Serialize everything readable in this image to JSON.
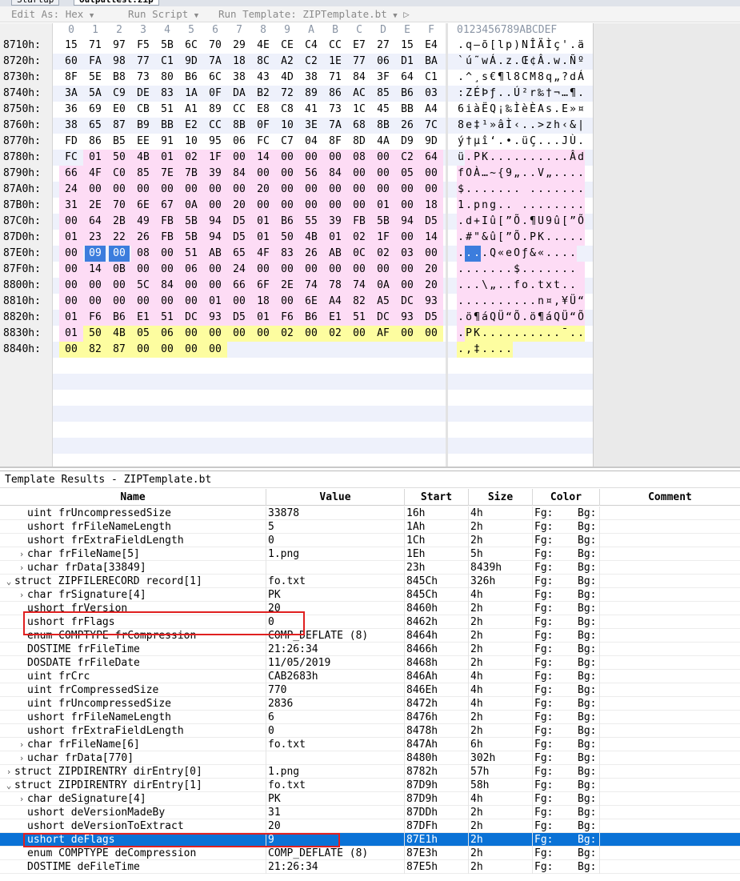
{
  "tabs": [
    {
      "label": "Startup",
      "active": false
    },
    {
      "label": "outputtest.zip",
      "active": true
    }
  ],
  "toolbar": {
    "edit_as": "Edit As: Hex",
    "run_script": "Run Script",
    "run_template": "Run Template: ZIPTemplate.bt"
  },
  "hex": {
    "column_header": [
      "0",
      "1",
      "2",
      "3",
      "4",
      "5",
      "6",
      "7",
      "8",
      "9",
      "A",
      "B",
      "C",
      "D",
      "E",
      "F"
    ],
    "ascii_header": "0123456789ABCDEF",
    "rows": [
      {
        "addr": "8710h:",
        "bytes": [
          "15",
          "71",
          "97",
          "F5",
          "5B",
          "6C",
          "70",
          "29",
          "4E",
          "CE",
          "C4",
          "CC",
          "E7",
          "27",
          "15",
          "E4"
        ],
        "ascii": ".q—õ[lp)NÎÄÌç'.ä"
      },
      {
        "addr": "8720h:",
        "bytes": [
          "60",
          "FA",
          "98",
          "77",
          "C1",
          "9D",
          "7A",
          "18",
          "8C",
          "A2",
          "C2",
          "1E",
          "77",
          "06",
          "D1",
          "BA"
        ],
        "ascii": "`ú˜wÁ.z.Œ¢Â.w.Ñº"
      },
      {
        "addr": "8730h:",
        "bytes": [
          "8F",
          "5E",
          "B8",
          "73",
          "80",
          "B6",
          "6C",
          "38",
          "43",
          "4D",
          "38",
          "71",
          "84",
          "3F",
          "64",
          "C1"
        ],
        "ascii": ".^¸s€¶l8CM8q„?dÁ"
      },
      {
        "addr": "8740h:",
        "bytes": [
          "3A",
          "5A",
          "C9",
          "DE",
          "83",
          "1A",
          "0F",
          "DA",
          "B2",
          "72",
          "89",
          "86",
          "AC",
          "85",
          "B6",
          "03"
        ],
        "ascii": ":ZÉÞƒ..Ú²r‰†¬…¶."
      },
      {
        "addr": "8750h:",
        "bytes": [
          "36",
          "69",
          "E0",
          "CB",
          "51",
          "A1",
          "89",
          "CC",
          "E8",
          "C8",
          "41",
          "73",
          "1C",
          "45",
          "BB",
          "A4"
        ],
        "ascii": "6iàËQ¡‰ÌèÈAs.E»¤"
      },
      {
        "addr": "8760h:",
        "bytes": [
          "38",
          "65",
          "87",
          "B9",
          "BB",
          "E2",
          "CC",
          "8B",
          "0F",
          "10",
          "3E",
          "7A",
          "68",
          "8B",
          "26",
          "7C"
        ],
        "ascii": "8e‡¹»âÌ‹..>zh‹&|"
      },
      {
        "addr": "8770h:",
        "bytes": [
          "FD",
          "86",
          "B5",
          "EE",
          "91",
          "10",
          "95",
          "06",
          "FC",
          "C7",
          "04",
          "8F",
          "8D",
          "4A",
          "D9",
          "9D"
        ],
        "ascii": "ý†µî‘.•.üÇ...JÙ."
      },
      {
        "addr": "8780h:",
        "bytes": [
          "FC",
          "01",
          "50",
          "4B",
          "01",
          "02",
          "1F",
          "00",
          "14",
          "00",
          "00",
          "00",
          "08",
          "00",
          "C2",
          "64"
        ],
        "ascii": "ü.PK..........Âd"
      },
      {
        "addr": "8790h:",
        "bytes": [
          "66",
          "4F",
          "C0",
          "85",
          "7E",
          "7B",
          "39",
          "84",
          "00",
          "00",
          "56",
          "84",
          "00",
          "00",
          "05",
          "00"
        ],
        "ascii": "fOÀ…~{9„..V„...."
      },
      {
        "addr": "87A0h:",
        "bytes": [
          "24",
          "00",
          "00",
          "00",
          "00",
          "00",
          "00",
          "00",
          "20",
          "00",
          "00",
          "00",
          "00",
          "00",
          "00",
          "00"
        ],
        "ascii": "$....... ......."
      },
      {
        "addr": "87B0h:",
        "bytes": [
          "31",
          "2E",
          "70",
          "6E",
          "67",
          "0A",
          "00",
          "20",
          "00",
          "00",
          "00",
          "00",
          "00",
          "01",
          "00",
          "18"
        ],
        "ascii": "1.png.. ........"
      },
      {
        "addr": "87C0h:",
        "bytes": [
          "00",
          "64",
          "2B",
          "49",
          "FB",
          "5B",
          "94",
          "D5",
          "01",
          "B6",
          "55",
          "39",
          "FB",
          "5B",
          "94",
          "D5"
        ],
        "ascii": ".d+Iû[”Õ.¶U9û[”Õ"
      },
      {
        "addr": "87D0h:",
        "bytes": [
          "01",
          "23",
          "22",
          "26",
          "FB",
          "5B",
          "94",
          "D5",
          "01",
          "50",
          "4B",
          "01",
          "02",
          "1F",
          "00",
          "14"
        ],
        "ascii": ".#\"&û[”Õ.PK....."
      },
      {
        "addr": "87E0h:",
        "bytes": [
          "00",
          "09",
          "00",
          "08",
          "00",
          "51",
          "AB",
          "65",
          "4F",
          "83",
          "26",
          "AB",
          "0C",
          "02",
          "03",
          "00"
        ],
        "ascii": "....Q«eOƒ&«...."
      },
      {
        "addr": "87F0h:",
        "bytes": [
          "00",
          "14",
          "0B",
          "00",
          "00",
          "06",
          "00",
          "24",
          "00",
          "00",
          "00",
          "00",
          "00",
          "00",
          "00",
          "20"
        ],
        "ascii": ".......$....... "
      },
      {
        "addr": "8800h:",
        "bytes": [
          "00",
          "00",
          "00",
          "5C",
          "84",
          "00",
          "00",
          "66",
          "6F",
          "2E",
          "74",
          "78",
          "74",
          "0A",
          "00",
          "20"
        ],
        "ascii": "...\\„..fo.txt.. "
      },
      {
        "addr": "8810h:",
        "bytes": [
          "00",
          "00",
          "00",
          "00",
          "00",
          "00",
          "01",
          "00",
          "18",
          "00",
          "6E",
          "A4",
          "82",
          "A5",
          "DC",
          "93",
          "D5"
        ],
        "ascii": "..........n¤‚¥Ü“Õ"
      },
      {
        "addr": "8820h:",
        "bytes": [
          "01",
          "F6",
          "B6",
          "E1",
          "51",
          "DC",
          "93",
          "D5",
          "01",
          "F6",
          "B6",
          "E1",
          "51",
          "DC",
          "93",
          "D5"
        ],
        "ascii": ".ö¶áQÜ“Õ.ö¶áQÜ“Õ"
      },
      {
        "addr": "8830h:",
        "bytes": [
          "01",
          "50",
          "4B",
          "05",
          "06",
          "00",
          "00",
          "00",
          "00",
          "02",
          "00",
          "02",
          "00",
          "AF",
          "00",
          "00"
        ],
        "ascii": ".PK..........¯.."
      },
      {
        "addr": "8840h:",
        "bytes": [
          "00",
          "82",
          "87",
          "00",
          "00",
          "00",
          "00"
        ],
        "ascii": ".‚‡...."
      }
    ]
  },
  "template_results": {
    "title": "Template Results - ZIPTemplate.bt",
    "columns": [
      "Name",
      "Value",
      "Start",
      "Size",
      "Color",
      "Comment"
    ],
    "fg_label": "Fg:",
    "bg_label": "Bg:",
    "rows": [
      {
        "indent": 2,
        "caret": "",
        "name": "uint frUncompressedSize",
        "value": "33878",
        "start": "16h",
        "size": "4h"
      },
      {
        "indent": 2,
        "caret": "",
        "name": "ushort frFileNameLength",
        "value": "5",
        "start": "1Ah",
        "size": "2h"
      },
      {
        "indent": 2,
        "caret": "",
        "name": "ushort frExtraFieldLength",
        "value": "0",
        "start": "1Ch",
        "size": "2h"
      },
      {
        "indent": 1,
        "caret": "›",
        "name": "char frFileName[5]",
        "value": "1.png",
        "start": "1Eh",
        "size": "5h"
      },
      {
        "indent": 1,
        "caret": "›",
        "name": "uchar frData[33849]",
        "value": "",
        "start": "23h",
        "size": "8439h"
      },
      {
        "indent": 0,
        "caret": "⌄",
        "name": "struct ZIPFILERECORD record[1]",
        "value": "fo.txt",
        "start": "845Ch",
        "size": "326h"
      },
      {
        "indent": 1,
        "caret": "›",
        "name": "char frSignature[4]",
        "value": "PK",
        "start": "845Ch",
        "size": "4h"
      },
      {
        "indent": 2,
        "caret": "",
        "name": "ushort frVersion",
        "value": "20",
        "start": "8460h",
        "size": "2h"
      },
      {
        "indent": 2,
        "caret": "",
        "name": "ushort frFlags",
        "value": "0",
        "start": "8462h",
        "size": "2h"
      },
      {
        "indent": 2,
        "caret": "",
        "name": "enum COMPTYPE frCompression",
        "value": "COMP_DEFLATE (8)",
        "start": "8464h",
        "size": "2h"
      },
      {
        "indent": 2,
        "caret": "",
        "name": "DOSTIME frFileTime",
        "value": "21:26:34",
        "start": "8466h",
        "size": "2h"
      },
      {
        "indent": 2,
        "caret": "",
        "name": "DOSDATE frFileDate",
        "value": "11/05/2019",
        "start": "8468h",
        "size": "2h"
      },
      {
        "indent": 2,
        "caret": "",
        "name": "uint frCrc",
        "value": "CAB2683h",
        "start": "846Ah",
        "size": "4h"
      },
      {
        "indent": 2,
        "caret": "",
        "name": "uint frCompressedSize",
        "value": "770",
        "start": "846Eh",
        "size": "4h"
      },
      {
        "indent": 2,
        "caret": "",
        "name": "uint frUncompressedSize",
        "value": "2836",
        "start": "8472h",
        "size": "4h"
      },
      {
        "indent": 2,
        "caret": "",
        "name": "ushort frFileNameLength",
        "value": "6",
        "start": "8476h",
        "size": "2h"
      },
      {
        "indent": 2,
        "caret": "",
        "name": "ushort frExtraFieldLength",
        "value": "0",
        "start": "8478h",
        "size": "2h"
      },
      {
        "indent": 1,
        "caret": "›",
        "name": "char frFileName[6]",
        "value": "fo.txt",
        "start": "847Ah",
        "size": "6h"
      },
      {
        "indent": 1,
        "caret": "›",
        "name": "uchar frData[770]",
        "value": "",
        "start": "8480h",
        "size": "302h"
      },
      {
        "indent": 0,
        "caret": "›",
        "name": "struct ZIPDIRENTRY dirEntry[0]",
        "value": "1.png",
        "start": "8782h",
        "size": "57h"
      },
      {
        "indent": 0,
        "caret": "⌄",
        "name": "struct ZIPDIRENTRY dirEntry[1]",
        "value": "fo.txt",
        "start": "87D9h",
        "size": "58h"
      },
      {
        "indent": 1,
        "caret": "›",
        "name": "char deSignature[4]",
        "value": "PK",
        "start": "87D9h",
        "size": "4h"
      },
      {
        "indent": 2,
        "caret": "",
        "name": "ushort deVersionMadeBy",
        "value": "31",
        "start": "87DDh",
        "size": "2h"
      },
      {
        "indent": 2,
        "caret": "",
        "name": "ushort deVersionToExtract",
        "value": "20",
        "start": "87DFh",
        "size": "2h"
      },
      {
        "indent": 2,
        "caret": "",
        "name": "ushort deFlags",
        "value": "9",
        "start": "87E1h",
        "size": "2h",
        "selected": true
      },
      {
        "indent": 2,
        "caret": "",
        "name": "enum COMPTYPE deCompression",
        "value": "COMP_DEFLATE (8)",
        "start": "87E3h",
        "size": "2h"
      },
      {
        "indent": 2,
        "caret": "",
        "name": "DOSTIME deFileTime",
        "value": "21:26:34",
        "start": "87E5h",
        "size": "2h"
      }
    ]
  },
  "colors": {
    "selection": "#0a72d6",
    "highlight_pink": "#fddcf5",
    "highlight_yellow": "#fdfda0",
    "annotation_red": "#e02020"
  }
}
